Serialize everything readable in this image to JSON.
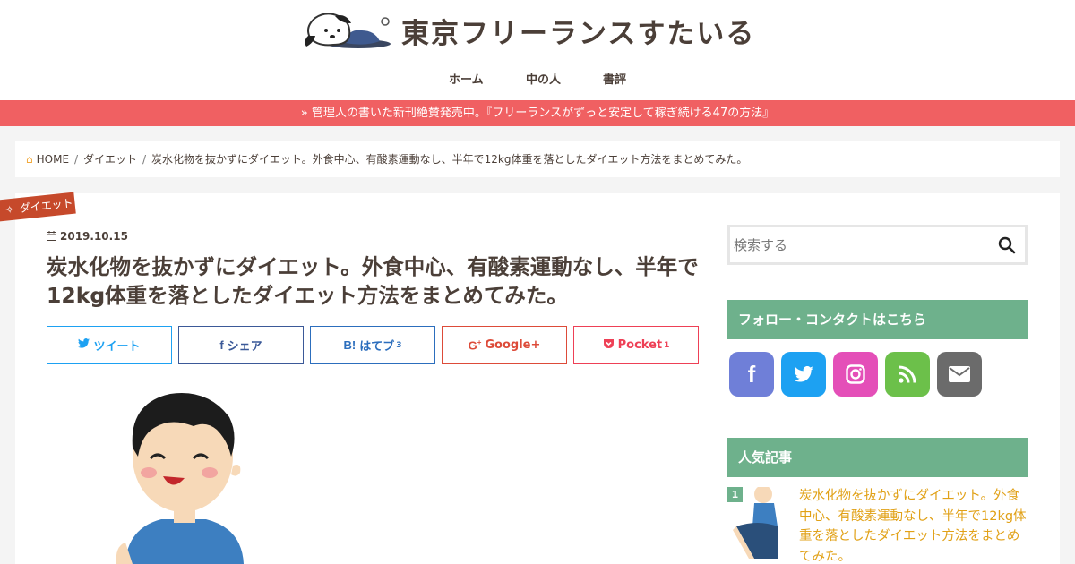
{
  "site": {
    "title": "東京フリーランスすたいる"
  },
  "nav": {
    "items": [
      {
        "label": "ホーム"
      },
      {
        "label": "中の人"
      },
      {
        "label": "書評"
      }
    ]
  },
  "banner": {
    "text": "» 管理人の書いた新刊絶賛発売中。『フリーランスがずっと安定して稼ぎ続ける47の方法』"
  },
  "breadcrumb": {
    "home": "HOME",
    "category": "ダイエット",
    "current": "炭水化物を抜かずにダイエット。外食中心、有酸素運動なし、半年で12kg体重を落としたダイエット方法をまとめてみた。"
  },
  "article": {
    "category": "ダイエット",
    "date": "2019.10.15",
    "title": "炭水化物を抜かずにダイエット。外食中心、有酸素運動なし、半年で12kg体重を落としたダイエット方法をまとめてみた。"
  },
  "share": {
    "tweet": "ツイート",
    "facebook": "シェア",
    "hatena": "はてブ",
    "hatena_count": "3",
    "google": "Google+",
    "pocket": "Pocket",
    "pocket_count": "1"
  },
  "sidebar": {
    "search_placeholder": "検索する",
    "follow_title": "フォロー・コンタクトはこちら",
    "popular_title": "人気記事",
    "popular": [
      {
        "rank": "1",
        "title": "炭水化物を抜かずにダイエット。外食中心、有酸素運動なし、半年で12kg体重を落としたダイエット方法をまとめてみた。"
      }
    ]
  },
  "colors": {
    "accent": "#f06062",
    "widget": "#6eb18c",
    "category": "#c6492b",
    "link": "#e1a117",
    "twitter": "#1da1f2",
    "facebook": "#3b5998",
    "hatena": "#2c6ebd",
    "google": "#dd4b39",
    "pocket": "#ee4056",
    "sns_facebook": "#6f7fd8",
    "sns_twitter": "#1da1f2",
    "sns_instagram": "#e44fb8",
    "sns_rss": "#6cc04a",
    "sns_mail": "#6b6b6b"
  }
}
